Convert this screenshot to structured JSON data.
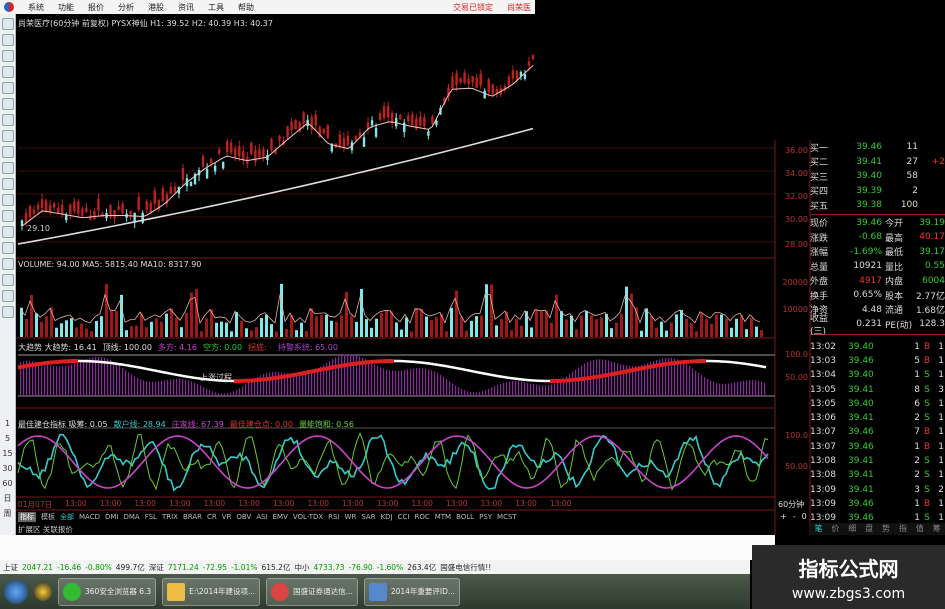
{
  "menu": {
    "items": [
      "系统",
      "功能",
      "报价",
      "分析",
      "港股",
      "资讯",
      "工具",
      "帮助"
    ],
    "lock_status": "交易已锁定",
    "stock_short": "尚荣医"
  },
  "chart": {
    "title": "尚荣医疗(60分钟 前复权) PYSX神仙 H1: 39.52 H2: 40.39 H3: 40.37",
    "low_marker": "29.10",
    "price_axis": [
      "36.00",
      "34.00",
      "32.00",
      "30.00",
      "28.00"
    ],
    "price_anchors": [
      29.9,
      31.2,
      30.9,
      30.6,
      30.8,
      30.8,
      30.7,
      31.8,
      33.5,
      34.8,
      35.8,
      35.4,
      35.7,
      37.2,
      38.6,
      36.8,
      36.4,
      38.2,
      38.7,
      38.3,
      38.0,
      41.4,
      41.5,
      40.8,
      41.8,
      43.4
    ],
    "long_ma": [
      28.1,
      37.8
    ],
    "colors": {
      "up": "#c0201e",
      "down": "#7fe8e8",
      "ma": "#dddddd",
      "axis": "#b33333"
    }
  },
  "volume": {
    "label": "VOLUME: 94.00  MA5: 5815.40  MA10: 8317.90",
    "axis": [
      "20000",
      "10000"
    ]
  },
  "ind1": {
    "items": [
      {
        "t": "大趋势  大趋势: 16.41",
        "c": "#ddd"
      },
      {
        "t": "顶线: 100.00",
        "c": "#ddd"
      },
      {
        "t": "多方: 4.16",
        "c": "#c4c"
      },
      {
        "t": "空方: 0.00",
        "c": "#3c3"
      },
      {
        "t": "拐底: ·",
        "c": "#d33"
      },
      {
        "t": "持警系统: 65.00",
        "c": "#a4c"
      }
    ],
    "annotation": "上涨过程",
    "axis": [
      "100.0",
      "50.00"
    ]
  },
  "ind2": {
    "items": [
      {
        "t": "最佳建仓指标  吸筹: 0.05",
        "c": "#ddd"
      },
      {
        "t": "散户线: 28.94",
        "c": "#3cc"
      },
      {
        "t": "庄家线: 67.39",
        "c": "#c4c"
      },
      {
        "t": "最佳建仓点: 0.00",
        "c": "#d33"
      },
      {
        "t": "量能饱和: 0.56",
        "c": "#6c3"
      }
    ],
    "axis": [
      "100.0",
      "50.00"
    ]
  },
  "periods": [
    "1",
    "5",
    "15",
    "30",
    "60",
    "日",
    "周"
  ],
  "time_axis": [
    "01月07日",
    "13:00",
    "13:00",
    "13:00",
    "13:00",
    "13:00",
    "13:00",
    "13:00",
    "13:00",
    "13:00",
    "13:00",
    "13:00",
    "13:00",
    "13:00",
    "13:00",
    "13:00"
  ],
  "period_label": "60分钟",
  "zoom_controls": [
    "+",
    "-",
    "0"
  ],
  "tabs": [
    "指标",
    "模板",
    "全部",
    "MACD",
    "DMI",
    "DMA",
    "FSL",
    "TRIX",
    "BRAR",
    "CR",
    "VR",
    "OBV",
    "ASI",
    "EMV",
    "VOL-TDX",
    "RSI",
    "WR",
    "SAR",
    "KDJ",
    "CCI",
    "ROC",
    "MTM",
    "BOLL",
    "PSY",
    "MCST"
  ],
  "ext_bar": "扩展区  关联报价",
  "orderbook": [
    {
      "l": "买一",
      "p": "39.46",
      "v": "11"
    },
    {
      "l": "买二",
      "p": "39.41",
      "v": "27",
      "x": "+2"
    },
    {
      "l": "买三",
      "p": "39.40",
      "v": "58"
    },
    {
      "l": "买四",
      "p": "39.39",
      "v": "2"
    },
    {
      "l": "买五",
      "p": "39.38",
      "v": "100"
    }
  ],
  "stats": [
    {
      "l1": "现价",
      "v1": "39.46",
      "l2": "今开",
      "v2": "39.19",
      "c1": "#3c3",
      "c2": "#3c3"
    },
    {
      "l1": "涨跌",
      "v1": "-0.68",
      "l2": "最高",
      "v2": "40.17",
      "c1": "#3c3",
      "c2": "#e33"
    },
    {
      "l1": "涨幅",
      "v1": "-1.69%",
      "l2": "最低",
      "v2": "39.17",
      "c1": "#3c3",
      "c2": "#3c3"
    },
    {
      "l1": "总量",
      "v1": "10921",
      "l2": "量比",
      "v2": "0.55",
      "c1": "#ddd",
      "c2": "#3c3"
    },
    {
      "l1": "外盘",
      "v1": "4917",
      "l2": "内盘",
      "v2": "6004",
      "c1": "#e33",
      "c2": "#3c3"
    },
    {
      "l1": "换手",
      "v1": "0.65%",
      "l2": "股本",
      "v2": "2.77亿",
      "c1": "#ddd",
      "c2": "#ddd"
    },
    {
      "l1": "净资",
      "v1": "4.48",
      "l2": "流通",
      "v2": "1.68亿",
      "c1": "#ddd",
      "c2": "#ddd"
    },
    {
      "l1": "收益(三)",
      "v1": "0.231",
      "l2": "PE(动)",
      "v2": "128.3",
      "c1": "#ddd",
      "c2": "#ddd"
    }
  ],
  "ticks": [
    [
      "13:02",
      "39.40",
      "1",
      "B",
      "1"
    ],
    [
      "13:03",
      "39.46",
      "5",
      "B",
      "1"
    ],
    [
      "13:04",
      "39.40",
      "1",
      "S",
      "1"
    ],
    [
      "13:05",
      "39.41",
      "8",
      "S",
      "3"
    ],
    [
      "13:05",
      "39.40",
      "6",
      "S",
      "1"
    ],
    [
      "13:06",
      "39.41",
      "2",
      "S",
      "1"
    ],
    [
      "13:07",
      "39.46",
      "7",
      "B",
      "1"
    ],
    [
      "13:07",
      "39.46",
      "1",
      "B",
      "1"
    ],
    [
      "13:08",
      "39.41",
      "2",
      "S",
      "1"
    ],
    [
      "13:08",
      "39.41",
      "2",
      "S",
      "1"
    ],
    [
      "13:09",
      "39.41",
      "3",
      "S",
      "2"
    ],
    [
      "13:09",
      "39.46",
      "1",
      "B",
      "1"
    ],
    [
      "13:09",
      "39.46",
      "1",
      "S",
      "1"
    ]
  ],
  "right_tabs": [
    "笔",
    "价",
    "细",
    "盘",
    "势",
    "指",
    "值",
    "筹"
  ],
  "status": [
    {
      "t": "上证",
      "c": "#222"
    },
    {
      "t": "2047.21",
      "c": "#090"
    },
    {
      "t": "-16.46",
      "c": "#090"
    },
    {
      "t": "-0.80%",
      "c": "#090"
    },
    {
      "t": "499.7亿",
      "c": "#222"
    },
    {
      "t": "深证",
      "c": "#222"
    },
    {
      "t": "7171.24",
      "c": "#090"
    },
    {
      "t": "-72.95",
      "c": "#090"
    },
    {
      "t": "-1.01%",
      "c": "#090"
    },
    {
      "t": "615.2亿",
      "c": "#222"
    },
    {
      "t": "中小",
      "c": "#222"
    },
    {
      "t": "4733.73",
      "c": "#090"
    },
    {
      "t": "-76.90",
      "c": "#090"
    },
    {
      "t": "-1.60%",
      "c": "#090"
    },
    {
      "t": "263.4亿",
      "c": "#222"
    },
    {
      "t": "国盛电信行情!!",
      "c": "#222"
    }
  ],
  "taskbar": [
    "360安全浏览器 6.3",
    "E:\\2014年建设项...",
    "国盛证券通达信...",
    "2014年重要评ID..."
  ],
  "watermark": {
    "name": "指标公式网",
    "url": "www.zbgs3.com"
  }
}
